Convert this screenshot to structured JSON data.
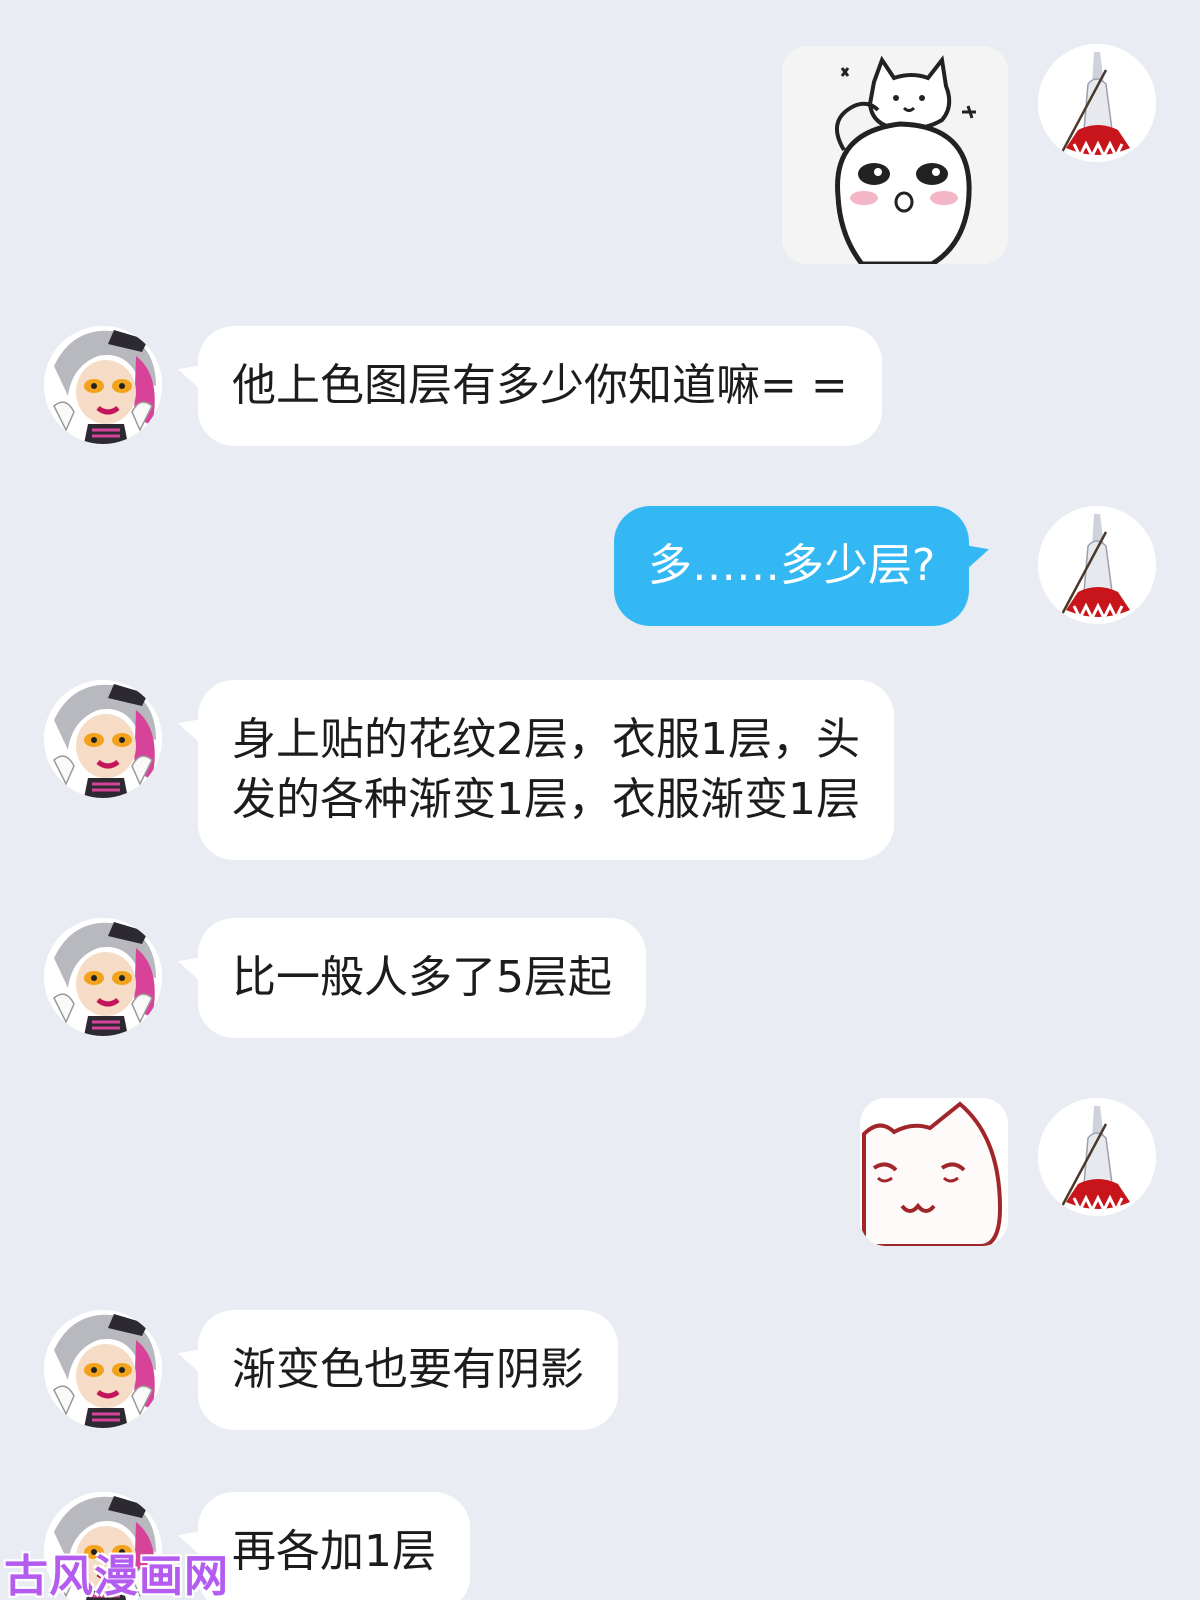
{
  "colors": {
    "background": "#e9edf3",
    "incoming_bubble": "#ffffff",
    "outgoing_bubble": "#34b8f4"
  },
  "messages": [
    {
      "sender": "self",
      "kind": "sticker",
      "sticker": "cat-on-head-sticker"
    },
    {
      "sender": "other",
      "kind": "text",
      "lines": [
        "他上色图层有多少你知道嘛= ="
      ]
    },
    {
      "sender": "self",
      "kind": "text",
      "lines": [
        "多……多少层?"
      ]
    },
    {
      "sender": "other",
      "kind": "text",
      "lines": [
        "身上贴的花纹2层，衣服1层，头",
        "发的各种渐变1层，衣服渐变1层"
      ]
    },
    {
      "sender": "other",
      "kind": "text",
      "lines": [
        "比一般人多了5层起"
      ]
    },
    {
      "sender": "self",
      "kind": "sticker",
      "sticker": "smug-cat-sticker"
    },
    {
      "sender": "other",
      "kind": "text",
      "lines": [
        "渐变色也要有阴影"
      ]
    },
    {
      "sender": "other",
      "kind": "text",
      "lines": [
        "再各加1层"
      ]
    }
  ],
  "watermark": "古风漫画网"
}
